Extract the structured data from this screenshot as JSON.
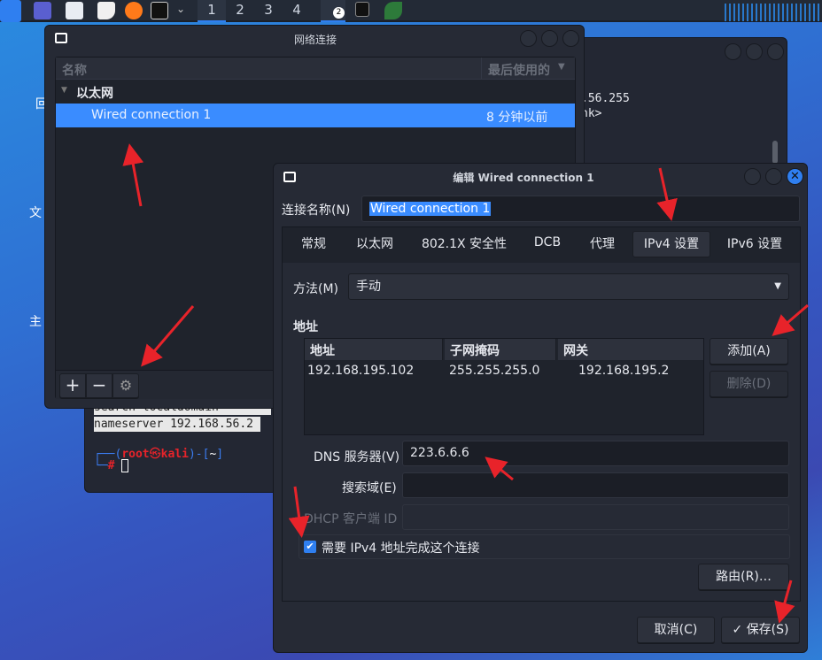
{
  "taskbar": {
    "workspaces": [
      "1",
      "2",
      "3",
      "4"
    ],
    "active_workspace": "1",
    "window_badge": "2"
  },
  "desktop": {
    "icons": [
      "回",
      "文",
      "主"
    ]
  },
  "terminal": {
    "lines_right": [
      ".56.255",
      "nk>"
    ],
    "line_search": "search localdomain",
    "line_nameserver": "nameserver 192.168.56.2",
    "prompt_user": "root",
    "prompt_at": "㉿",
    "prompt_host": "kali",
    "prompt_dir": "~",
    "prompt_hash": "#"
  },
  "netwin": {
    "title": "网络连接",
    "col_name": "名称",
    "col_last_used": "最后使用的",
    "group": "以太网",
    "connections": [
      {
        "name": "Wired connection 1",
        "last_used": "8 分钟以前"
      }
    ]
  },
  "editor": {
    "title": "编辑 Wired connection 1",
    "conn_name_label": "连接名称(N)",
    "conn_name_value": "Wired connection 1",
    "tabs": [
      "常规",
      "以太网",
      "802.1X 安全性",
      "DCB",
      "代理",
      "IPv4 设置",
      "IPv6 设置"
    ],
    "active_tab": "IPv4 设置",
    "method_label": "方法(M)",
    "method_value": "手动",
    "address_section": "地址",
    "address_columns": [
      "地址",
      "子网掩码",
      "网关"
    ],
    "addresses": [
      {
        "address": "192.168.195.102",
        "netmask": "255.255.255.0",
        "gateway": "192.168.195.2"
      }
    ],
    "add_button": "添加(A)",
    "delete_button": "删除(D)",
    "dns_label": "DNS 服务器(V)",
    "dns_value": "223.6.6.6",
    "search_label": "搜索域(E)",
    "search_value": "",
    "dhcp_label": "DHCP 客户端 ID",
    "dhcp_value": "",
    "require_ipv4_label": "需要 IPv4 地址完成这个连接",
    "require_ipv4_checked": true,
    "routes_button": "路由(R)…",
    "cancel_button": "取消(C)",
    "save_button": "保存(S)"
  },
  "colors": {
    "accent": "#3a8cff",
    "annotation": "#e8232a",
    "window_bg": "#262a35"
  }
}
